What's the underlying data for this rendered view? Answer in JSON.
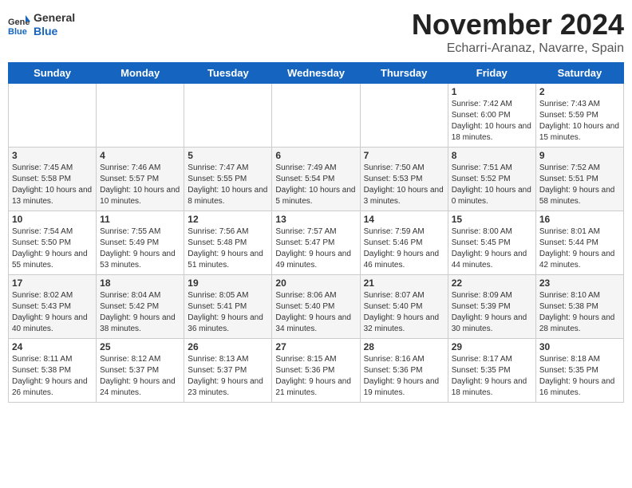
{
  "logo": {
    "general": "General",
    "blue": "Blue"
  },
  "title": "November 2024",
  "location": "Echarri-Aranaz, Navarre, Spain",
  "days_of_week": [
    "Sunday",
    "Monday",
    "Tuesday",
    "Wednesday",
    "Thursday",
    "Friday",
    "Saturday"
  ],
  "weeks": [
    [
      {
        "day": "",
        "info": ""
      },
      {
        "day": "",
        "info": ""
      },
      {
        "day": "",
        "info": ""
      },
      {
        "day": "",
        "info": ""
      },
      {
        "day": "",
        "info": ""
      },
      {
        "day": "1",
        "info": "Sunrise: 7:42 AM\nSunset: 6:00 PM\nDaylight: 10 hours and 18 minutes."
      },
      {
        "day": "2",
        "info": "Sunrise: 7:43 AM\nSunset: 5:59 PM\nDaylight: 10 hours and 15 minutes."
      }
    ],
    [
      {
        "day": "3",
        "info": "Sunrise: 7:45 AM\nSunset: 5:58 PM\nDaylight: 10 hours and 13 minutes."
      },
      {
        "day": "4",
        "info": "Sunrise: 7:46 AM\nSunset: 5:57 PM\nDaylight: 10 hours and 10 minutes."
      },
      {
        "day": "5",
        "info": "Sunrise: 7:47 AM\nSunset: 5:55 PM\nDaylight: 10 hours and 8 minutes."
      },
      {
        "day": "6",
        "info": "Sunrise: 7:49 AM\nSunset: 5:54 PM\nDaylight: 10 hours and 5 minutes."
      },
      {
        "day": "7",
        "info": "Sunrise: 7:50 AM\nSunset: 5:53 PM\nDaylight: 10 hours and 3 minutes."
      },
      {
        "day": "8",
        "info": "Sunrise: 7:51 AM\nSunset: 5:52 PM\nDaylight: 10 hours and 0 minutes."
      },
      {
        "day": "9",
        "info": "Sunrise: 7:52 AM\nSunset: 5:51 PM\nDaylight: 9 hours and 58 minutes."
      }
    ],
    [
      {
        "day": "10",
        "info": "Sunrise: 7:54 AM\nSunset: 5:50 PM\nDaylight: 9 hours and 55 minutes."
      },
      {
        "day": "11",
        "info": "Sunrise: 7:55 AM\nSunset: 5:49 PM\nDaylight: 9 hours and 53 minutes."
      },
      {
        "day": "12",
        "info": "Sunrise: 7:56 AM\nSunset: 5:48 PM\nDaylight: 9 hours and 51 minutes."
      },
      {
        "day": "13",
        "info": "Sunrise: 7:57 AM\nSunset: 5:47 PM\nDaylight: 9 hours and 49 minutes."
      },
      {
        "day": "14",
        "info": "Sunrise: 7:59 AM\nSunset: 5:46 PM\nDaylight: 9 hours and 46 minutes."
      },
      {
        "day": "15",
        "info": "Sunrise: 8:00 AM\nSunset: 5:45 PM\nDaylight: 9 hours and 44 minutes."
      },
      {
        "day": "16",
        "info": "Sunrise: 8:01 AM\nSunset: 5:44 PM\nDaylight: 9 hours and 42 minutes."
      }
    ],
    [
      {
        "day": "17",
        "info": "Sunrise: 8:02 AM\nSunset: 5:43 PM\nDaylight: 9 hours and 40 minutes."
      },
      {
        "day": "18",
        "info": "Sunrise: 8:04 AM\nSunset: 5:42 PM\nDaylight: 9 hours and 38 minutes."
      },
      {
        "day": "19",
        "info": "Sunrise: 8:05 AM\nSunset: 5:41 PM\nDaylight: 9 hours and 36 minutes."
      },
      {
        "day": "20",
        "info": "Sunrise: 8:06 AM\nSunset: 5:40 PM\nDaylight: 9 hours and 34 minutes."
      },
      {
        "day": "21",
        "info": "Sunrise: 8:07 AM\nSunset: 5:40 PM\nDaylight: 9 hours and 32 minutes."
      },
      {
        "day": "22",
        "info": "Sunrise: 8:09 AM\nSunset: 5:39 PM\nDaylight: 9 hours and 30 minutes."
      },
      {
        "day": "23",
        "info": "Sunrise: 8:10 AM\nSunset: 5:38 PM\nDaylight: 9 hours and 28 minutes."
      }
    ],
    [
      {
        "day": "24",
        "info": "Sunrise: 8:11 AM\nSunset: 5:38 PM\nDaylight: 9 hours and 26 minutes."
      },
      {
        "day": "25",
        "info": "Sunrise: 8:12 AM\nSunset: 5:37 PM\nDaylight: 9 hours and 24 minutes."
      },
      {
        "day": "26",
        "info": "Sunrise: 8:13 AM\nSunset: 5:37 PM\nDaylight: 9 hours and 23 minutes."
      },
      {
        "day": "27",
        "info": "Sunrise: 8:15 AM\nSunset: 5:36 PM\nDaylight: 9 hours and 21 minutes."
      },
      {
        "day": "28",
        "info": "Sunrise: 8:16 AM\nSunset: 5:36 PM\nDaylight: 9 hours and 19 minutes."
      },
      {
        "day": "29",
        "info": "Sunrise: 8:17 AM\nSunset: 5:35 PM\nDaylight: 9 hours and 18 minutes."
      },
      {
        "day": "30",
        "info": "Sunrise: 8:18 AM\nSunset: 5:35 PM\nDaylight: 9 hours and 16 minutes."
      }
    ]
  ]
}
